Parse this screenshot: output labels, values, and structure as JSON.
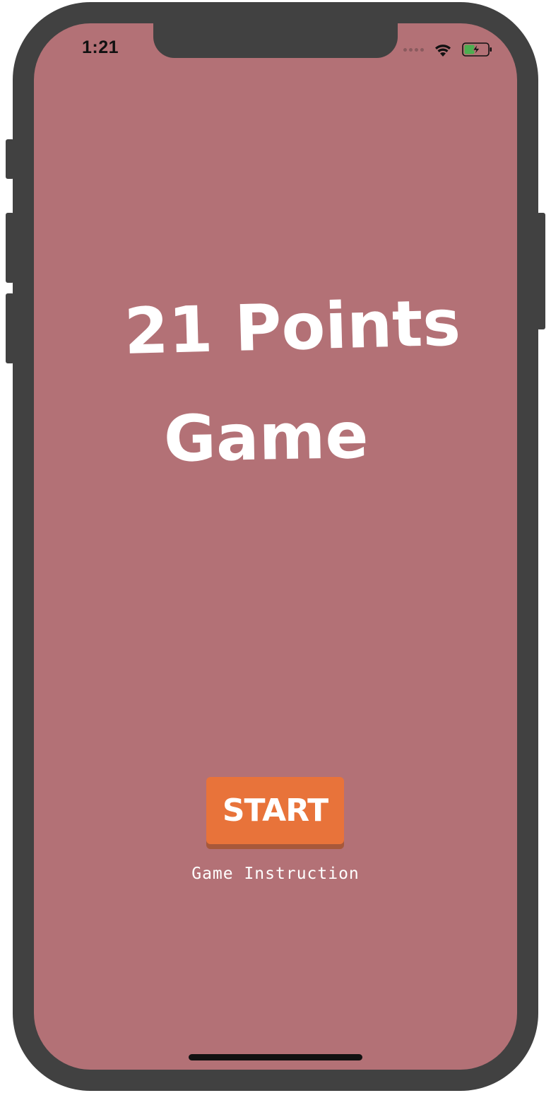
{
  "status_bar": {
    "time": "1:21",
    "icons": [
      "signal-dots-icon",
      "wifi-icon",
      "battery-charging-icon"
    ]
  },
  "title": {
    "line1": "21 Points",
    "line2": "Game"
  },
  "start_button": {
    "label": "START"
  },
  "instruction_link": {
    "label": "Game Instruction"
  },
  "colors": {
    "screen_background": "#b37176",
    "start_button": "#e8733a",
    "start_button_shadow": "#a7583a",
    "device_frame": "#414141",
    "battery_fill": "#4caf50"
  }
}
